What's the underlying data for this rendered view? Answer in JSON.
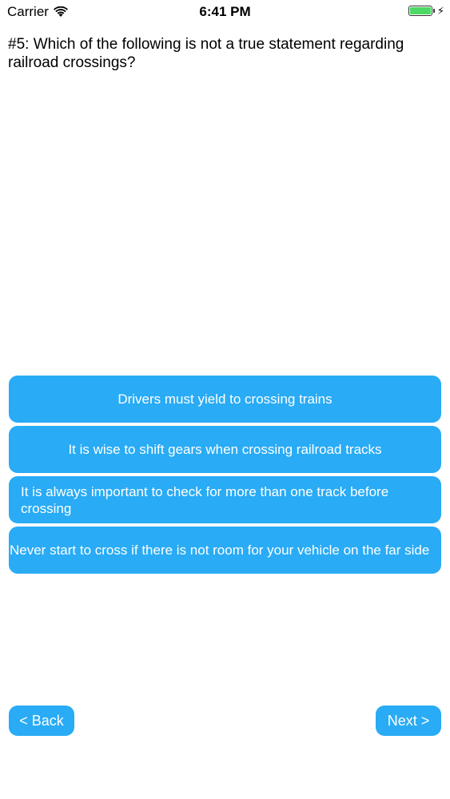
{
  "status_bar": {
    "carrier": "Carrier",
    "time": "6:41 PM",
    "battery_level": 1.0,
    "charging_icon": "bolt-icon",
    "colors": {
      "battery_fill": "#4cd964"
    }
  },
  "question": {
    "text": "#5: Which of the following is not a true statement regarding railroad crossings?"
  },
  "answers": [
    {
      "label": "Drivers must yield to crossing trains"
    },
    {
      "label": "It is wise to shift gears when crossing railroad tracks"
    },
    {
      "label": "It is always important to check for more than one track before crossing"
    },
    {
      "label": "Never start to cross if there is not room for your vehicle on the far side"
    }
  ],
  "navigation": {
    "back_label": "< Back",
    "next_label": "Next >"
  },
  "colors": {
    "accent": "#29abf5",
    "button_text": "#ffffff",
    "background": "#ffffff"
  }
}
